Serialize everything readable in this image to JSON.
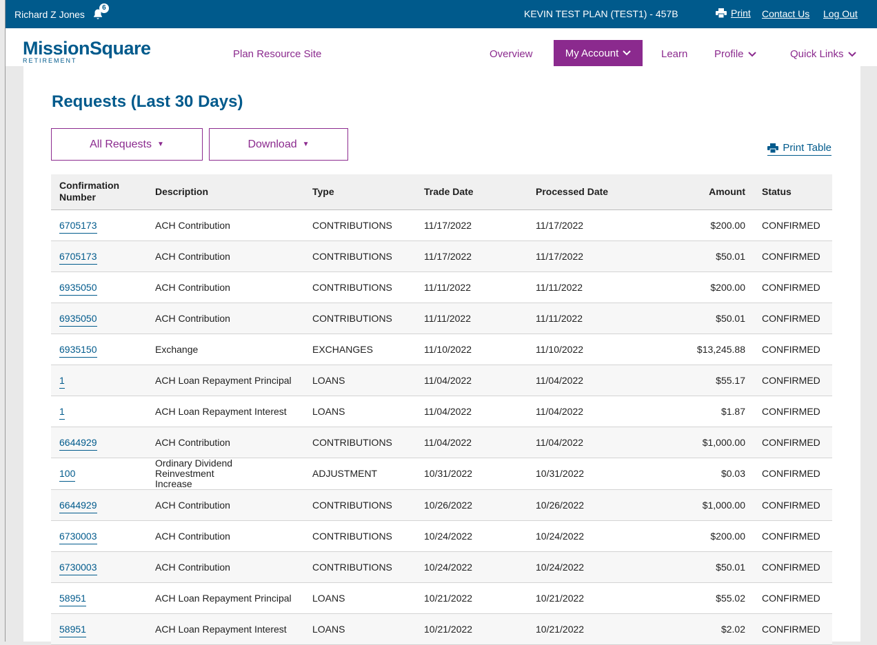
{
  "header": {
    "user_name": "Richard Z Jones",
    "notification_count": "6",
    "plan_name": "KEVIN TEST PLAN (TEST1) - 457B",
    "print_label": "Print",
    "contact_label": "Contact Us",
    "logout_label": "Log Out"
  },
  "nav": {
    "logo_text": "MissionSquare",
    "logo_sub": "RETIREMENT",
    "plan_resource": "Plan Resource Site",
    "overview": "Overview",
    "my_account": "My Account",
    "learn": "Learn",
    "profile": "Profile",
    "quick_links": "Quick Links"
  },
  "page": {
    "title": "Requests (Last 30 Days)",
    "filter_label": "All Requests",
    "download_label": "Download",
    "print_table_label": "Print Table"
  },
  "table": {
    "headers": [
      "Confirmation Number",
      "Description",
      "Type",
      "Trade Date",
      "Processed Date",
      "Amount",
      "Status"
    ],
    "rows": [
      [
        "6705173",
        "ACH Contribution",
        "CONTRIBUTIONS",
        "11/17/2022",
        "11/17/2022",
        "$200.00",
        "CONFIRMED"
      ],
      [
        "6705173",
        "ACH Contribution",
        "CONTRIBUTIONS",
        "11/17/2022",
        "11/17/2022",
        "$50.01",
        "CONFIRMED"
      ],
      [
        "6935050",
        "ACH Contribution",
        "CONTRIBUTIONS",
        "11/11/2022",
        "11/11/2022",
        "$200.00",
        "CONFIRMED"
      ],
      [
        "6935050",
        "ACH Contribution",
        "CONTRIBUTIONS",
        "11/11/2022",
        "11/11/2022",
        "$50.01",
        "CONFIRMED"
      ],
      [
        "6935150",
        "Exchange",
        "EXCHANGES",
        "11/10/2022",
        "11/10/2022",
        "$13,245.88",
        "CONFIRMED"
      ],
      [
        "1",
        "ACH Loan Repayment Principal",
        "LOANS",
        "11/04/2022",
        "11/04/2022",
        "$55.17",
        "CONFIRMED"
      ],
      [
        "1",
        "ACH Loan Repayment Interest",
        "LOANS",
        "11/04/2022",
        "11/04/2022",
        "$1.87",
        "CONFIRMED"
      ],
      [
        "6644929",
        "ACH Contribution",
        "CONTRIBUTIONS",
        "11/04/2022",
        "11/04/2022",
        "$1,000.00",
        "CONFIRMED"
      ],
      [
        "100",
        "Ordinary Dividend Reinvestment Increase",
        "ADJUSTMENT",
        "10/31/2022",
        "10/31/2022",
        "$0.03",
        "CONFIRMED"
      ],
      [
        "6644929",
        "ACH Contribution",
        "CONTRIBUTIONS",
        "10/26/2022",
        "10/26/2022",
        "$1,000.00",
        "CONFIRMED"
      ],
      [
        "6730003",
        "ACH Contribution",
        "CONTRIBUTIONS",
        "10/24/2022",
        "10/24/2022",
        "$200.00",
        "CONFIRMED"
      ],
      [
        "6730003",
        "ACH Contribution",
        "CONTRIBUTIONS",
        "10/24/2022",
        "10/24/2022",
        "$50.01",
        "CONFIRMED"
      ],
      [
        "58951",
        "ACH Loan Repayment Principal",
        "LOANS",
        "10/21/2022",
        "10/21/2022",
        "$55.02",
        "CONFIRMED"
      ],
      [
        "58951",
        "ACH Loan Repayment Interest",
        "LOANS",
        "10/21/2022",
        "10/21/2022",
        "$2.02",
        "CONFIRMED"
      ]
    ]
  },
  "colors": {
    "brand_blue": "#005a8c",
    "brand_purple": "#8b2a8e"
  },
  "icons": [
    "bell-icon",
    "printer-icon",
    "chevron-down-icon",
    "caret-down-icon"
  ]
}
